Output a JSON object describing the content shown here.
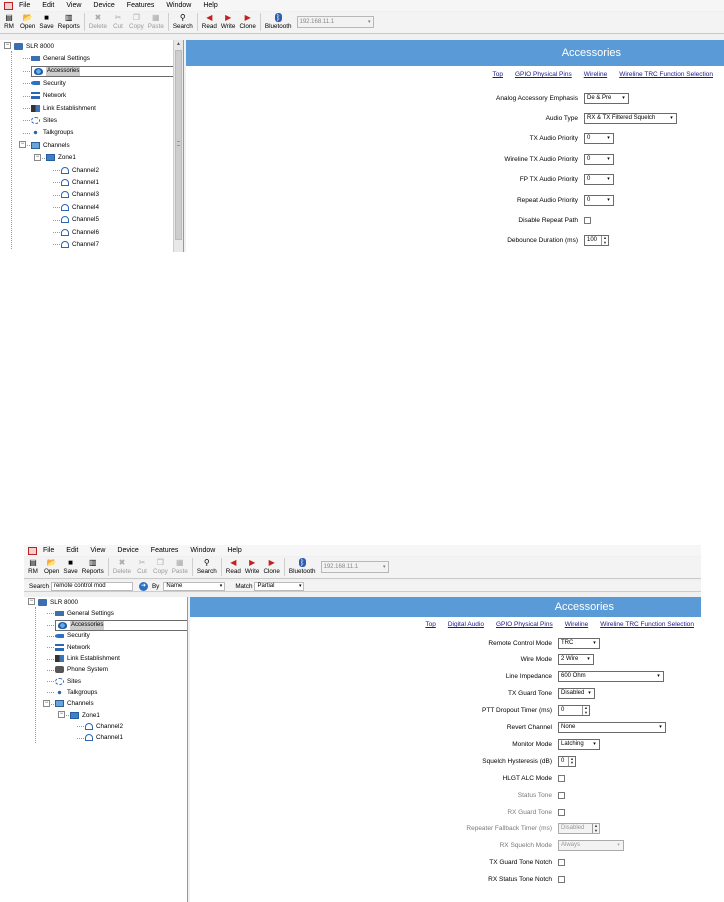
{
  "menu": [
    "File",
    "Edit",
    "View",
    "Device",
    "Features",
    "Window",
    "Help"
  ],
  "toolbar": [
    {
      "label": "RM",
      "icon": "rm-icon",
      "glyph": "▤",
      "enabled": true
    },
    {
      "label": "Open",
      "icon": "open-folder-icon",
      "glyph": "📂",
      "enabled": true
    },
    {
      "label": "Save",
      "icon": "save-disk-icon",
      "glyph": "■",
      "enabled": true
    },
    {
      "label": "Reports",
      "icon": "reports-icon",
      "glyph": "▥",
      "enabled": true
    },
    {
      "label": "Delete",
      "icon": "delete-x-icon",
      "glyph": "✖",
      "enabled": false
    },
    {
      "label": "Cut",
      "icon": "cut-scissors-icon",
      "glyph": "✂",
      "enabled": false
    },
    {
      "label": "Copy",
      "icon": "copy-icon",
      "glyph": "❐",
      "enabled": false
    },
    {
      "label": "Paste",
      "icon": "paste-icon",
      "glyph": "▦",
      "enabled": false
    },
    {
      "label": "Search",
      "icon": "search-icon",
      "glyph": "⚲",
      "enabled": true
    },
    {
      "label": "Read",
      "icon": "read-radio-icon",
      "glyph": "◀",
      "enabled": true
    },
    {
      "label": "Write",
      "icon": "write-radio-icon",
      "glyph": "▶",
      "enabled": true
    },
    {
      "label": "Clone",
      "icon": "clone-radio-icon",
      "glyph": "▶",
      "enabled": true
    },
    {
      "label": "Bluetooth",
      "icon": "bluetooth-icon",
      "glyph": "ᛒ",
      "enabled": true
    }
  ],
  "ip_address": "192.168.11.1",
  "colors": {
    "header_blue": "#5a9ad6",
    "link": "#1a1a8a",
    "selected_node": "#cccccc"
  },
  "screen1": {
    "header": "Accessories",
    "tree": [
      {
        "label": "SLR 8000",
        "icon": "device-icon"
      },
      {
        "label": "General Settings",
        "icon": "general-settings-icon"
      },
      {
        "label": "Accessories",
        "icon": "accessories-icon",
        "selected": true
      },
      {
        "label": "Security",
        "icon": "security-key-icon"
      },
      {
        "label": "Network",
        "icon": "network-icon"
      },
      {
        "label": "Link Establishment",
        "icon": "link-establishment-icon"
      },
      {
        "label": "Sites",
        "icon": "sites-icon"
      },
      {
        "label": "Talkgroups",
        "icon": "talkgroups-icon"
      },
      {
        "label": "Channels",
        "icon": "channels-folder-icon"
      },
      {
        "label": "Zone1",
        "icon": "zone-folder-icon"
      },
      {
        "label": "Channel2",
        "icon": "channel-icon"
      },
      {
        "label": "Channel1",
        "icon": "channel-icon"
      },
      {
        "label": "Channel3",
        "icon": "channel-icon"
      },
      {
        "label": "Channel4",
        "icon": "channel-icon"
      },
      {
        "label": "Channel5",
        "icon": "channel-icon"
      },
      {
        "label": "Channel6",
        "icon": "channel-icon"
      },
      {
        "label": "Channel7",
        "icon": "channel-icon"
      }
    ],
    "links": [
      "Top",
      "GPIO Physical Pins",
      "Wireline",
      "Wireline TRC Function Selection"
    ],
    "fields": [
      {
        "label": "Analog Accessory Emphasis",
        "type": "select",
        "value": "De & Pre"
      },
      {
        "label": "Audio Type",
        "type": "select",
        "value": "RX & TX Filtered Squelch"
      },
      {
        "label": "TX Audio Priority",
        "type": "select",
        "value": "0"
      },
      {
        "label": "Wireline TX Audio Priority",
        "type": "select",
        "value": "0"
      },
      {
        "label": "FP TX Audio Priority",
        "type": "select",
        "value": "0"
      },
      {
        "label": "Repeat Audio Priority",
        "type": "select",
        "value": "0"
      },
      {
        "label": "Disable Repeat Path",
        "type": "checkbox",
        "value": ""
      },
      {
        "label": "Debounce Duration (ms)",
        "type": "spin",
        "value": "100"
      }
    ]
  },
  "screen2": {
    "header": "Accessories",
    "search": {
      "label": "Search",
      "value": "remote control mod",
      "by_label": "By",
      "by_value": "Name",
      "match_label": "Match",
      "match_value": "Partial"
    },
    "tree": [
      {
        "label": "SLR 8000",
        "icon": "device-icon"
      },
      {
        "label": "General Settings",
        "icon": "general-settings-icon"
      },
      {
        "label": "Accessories",
        "icon": "accessories-icon",
        "selected": true
      },
      {
        "label": "Security",
        "icon": "security-key-icon"
      },
      {
        "label": "Network",
        "icon": "network-icon"
      },
      {
        "label": "Link Establishment",
        "icon": "link-establishment-icon"
      },
      {
        "label": "Phone System",
        "icon": "phone-system-icon"
      },
      {
        "label": "Sites",
        "icon": "sites-icon"
      },
      {
        "label": "Talkgroups",
        "icon": "talkgroups-icon"
      },
      {
        "label": "Channels",
        "icon": "channels-folder-icon"
      },
      {
        "label": "Zone1",
        "icon": "zone-folder-icon"
      },
      {
        "label": "Channel2",
        "icon": "channel-icon"
      },
      {
        "label": "Channel1",
        "icon": "channel-icon"
      }
    ],
    "links": [
      "Top",
      "Digital Audio",
      "GPIO Physical Pins",
      "Wireline",
      "Wireline TRC Function Selection"
    ],
    "fields": [
      {
        "label": "Remote Control Mode",
        "type": "select",
        "value": "TRC"
      },
      {
        "label": "Wire Mode",
        "type": "select",
        "value": "2 Wire"
      },
      {
        "label": "Line Impedance",
        "type": "select",
        "value": "600 Ohm"
      },
      {
        "label": "TX Guard Tone",
        "type": "select",
        "value": "Disabled"
      },
      {
        "label": "PTT Dropout Timer (ms)",
        "type": "spin",
        "value": "0"
      },
      {
        "label": "Revert Channel",
        "type": "select",
        "value": "None"
      },
      {
        "label": "Monitor Mode",
        "type": "select",
        "value": "Latching"
      },
      {
        "label": "Squelch Hysteresis (dB)",
        "type": "spin",
        "value": "0"
      },
      {
        "label": "HLGT ALC Mode",
        "type": "checkbox",
        "value": ""
      },
      {
        "label": "Status Tone",
        "type": "checkbox",
        "value": "",
        "dim": true
      },
      {
        "label": "RX Guard Tone",
        "type": "checkbox",
        "value": "",
        "dim": true
      },
      {
        "label": "Repeater Fallback Timer (ms)",
        "type": "spin",
        "value": "Disabled",
        "dim": true,
        "disabled": true
      },
      {
        "label": "RX Squelch Mode",
        "type": "select",
        "value": "Always",
        "dim": true,
        "disabled": true
      },
      {
        "label": "TX Guard Tone Notch",
        "type": "checkbox",
        "value": ""
      },
      {
        "label": "RX Status Tone Notch",
        "type": "checkbox",
        "value": ""
      }
    ]
  }
}
